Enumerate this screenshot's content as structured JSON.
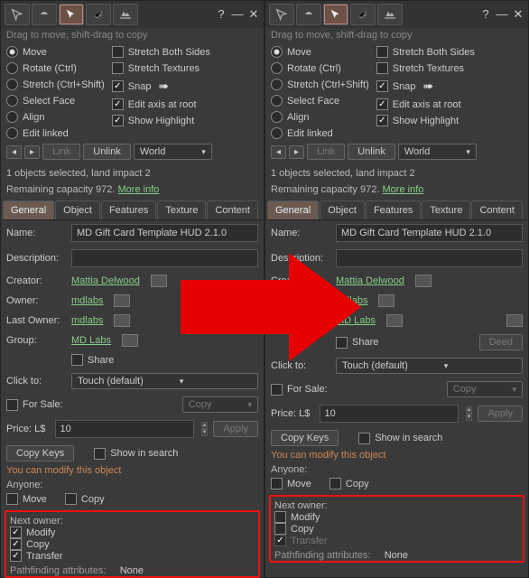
{
  "hint": "Drag to move, shift-drag to copy",
  "radios": {
    "move": "Move",
    "rotate": "Rotate (Ctrl)",
    "stretch": "Stretch (Ctrl+Shift)",
    "face": "Select Face",
    "align": "Align",
    "linked": "Edit linked"
  },
  "checks": {
    "both": "Stretch Both Sides",
    "tex": "Stretch Textures",
    "snap": "Snap",
    "axis": "Edit axis at root",
    "hl": "Show Highlight"
  },
  "link": "Link",
  "unlink": "Unlink",
  "coord": "World",
  "objects": "1 objects selected, land impact 2",
  "capacity": "Remaining capacity 972. ",
  "more": "More info",
  "tabs": {
    "general": "General",
    "object": "Object",
    "features": "Features",
    "texture": "Texture",
    "content": "Content"
  },
  "name_lbl": "Name:",
  "name_val": "MD Gift Card Template HUD 2.1.0",
  "desc_lbl": "Description:",
  "desc_val": "",
  "creator_lbl": "Creator:",
  "creator": "Mattia Delwood",
  "owner_lbl": "Owner:",
  "owner_l": "mdlabs",
  "owner_r": "mdlabs",
  "last_lbl": "Last Owner:",
  "last": "mdlabs",
  "group_lbl": "Group:",
  "group": "MD Labs",
  "share": "Share",
  "deed": "Deed",
  "click_lbl": "Click to:",
  "click_val": "Touch  (default)",
  "forsale": "For Sale:",
  "copy_btn": "Copy",
  "price_lbl": "Price: L$",
  "price": "10",
  "apply": "Apply",
  "copykeys": "Copy Keys",
  "showsearch": "Show in search",
  "modtxt": "You can modify this object",
  "anyone": "Anyone:",
  "a_move": "Move",
  "a_copy": "Copy",
  "next": "Next owner:",
  "n_mod": "Modify",
  "n_copy": "Copy",
  "n_trans": "Transfer",
  "path": "Pathfinding attributes:",
  "none": "None",
  "left_perms": {
    "modify": true,
    "copy": true,
    "transfer": true
  },
  "right_perms": {
    "modify": false,
    "copy": false,
    "transfer": true,
    "transfer_disabled": true
  }
}
